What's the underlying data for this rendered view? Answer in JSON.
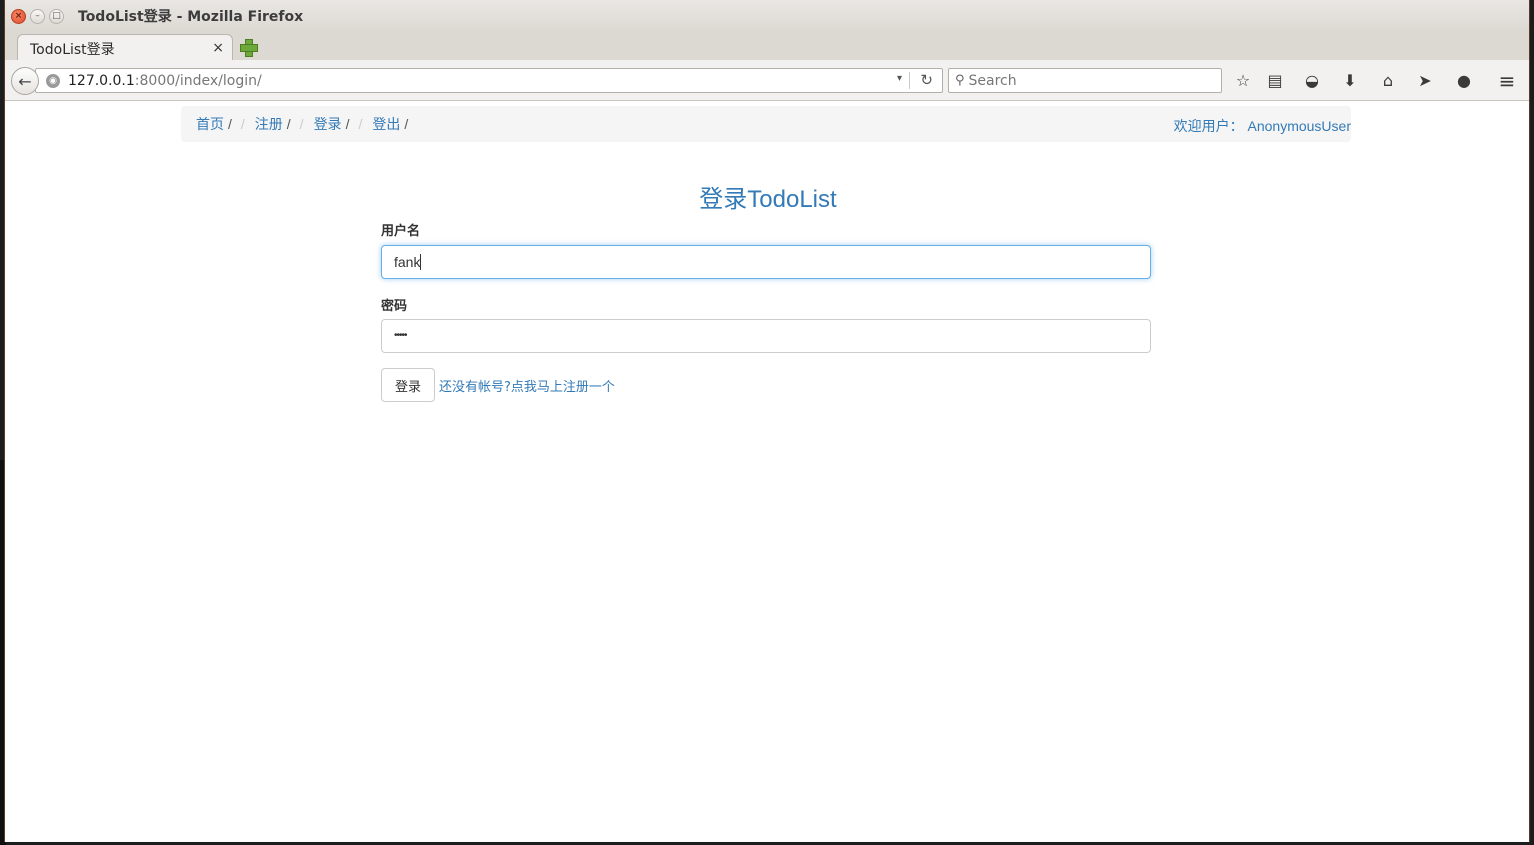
{
  "window": {
    "title": "TodoList登录 - Mozilla Firefox",
    "controls": {
      "close": "×",
      "minimize": "–",
      "maximize": "□"
    }
  },
  "tab": {
    "title": "TodoList登录",
    "close": "×"
  },
  "navbar": {
    "back_icon": "←",
    "url_host": "127.0.0.1",
    "url_rest": ":8000/index/login/",
    "url_dropdown": "▾",
    "reload_icon": "↻",
    "search_placeholder": "Search",
    "search_icon": "⚲",
    "toolbar_icons": {
      "bookmark": "☆",
      "reading_list": "▤",
      "pocket": "◒",
      "downloads": "⬇",
      "home": "⌂",
      "send": "➤",
      "chat": "●",
      "menu": "≡"
    }
  },
  "breadcrumb": {
    "items": [
      "首页",
      "注册",
      "登录",
      "登出"
    ],
    "separator": "/",
    "welcome_label": "欢迎用户：",
    "welcome_user": "AnonymousUser"
  },
  "form": {
    "title": "登录TodoList",
    "username_label": "用户名",
    "username_value": "fank",
    "password_label": "密码",
    "password_value": "•••••",
    "submit_label": "登录",
    "register_link": "还没有帐号?点我马上注册一个"
  },
  "colors": {
    "link": "#337ab7",
    "focus_border": "#66afe9"
  }
}
